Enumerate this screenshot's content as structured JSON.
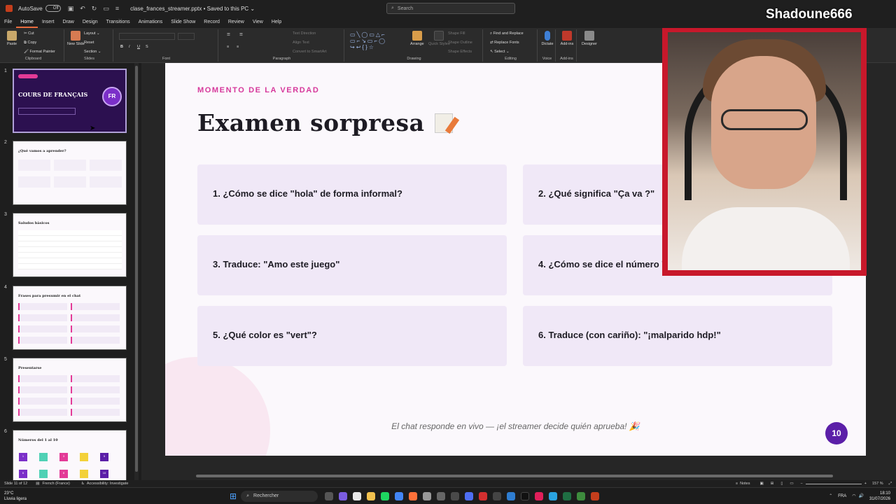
{
  "titlebar": {
    "autosave": "AutoSave",
    "toggle": "Off",
    "doc_title": "clase_frances_streamer.pptx • Saved to this PC ⌄",
    "search_placeholder": "Search"
  },
  "menu": [
    "File",
    "Home",
    "Insert",
    "Draw",
    "Design",
    "Transitions",
    "Animations",
    "Slide Show",
    "Record",
    "Review",
    "View",
    "Help"
  ],
  "ribbon": {
    "clipboard": {
      "paste": "Paste",
      "cut": "Cut",
      "copy": "Copy",
      "format_painter": "Format Painter",
      "name": "Clipboard"
    },
    "slides": {
      "new_slide": "New Slide",
      "layout": "Layout",
      "reset": "Reset",
      "section": "Section",
      "name": "Slides"
    },
    "font": {
      "name": "Font"
    },
    "paragraph": {
      "text_direction": "Text Direction",
      "align_text": "Align Text",
      "convert": "Convert to SmartArt",
      "name": "Paragraph"
    },
    "drawing": {
      "arrange": "Arrange",
      "quick_styles": "Quick Styles",
      "shape_fill": "Shape Fill",
      "shape_outline": "Shape Outline",
      "shape_effects": "Shape Effects",
      "name": "Drawing"
    },
    "editing": {
      "find_replace": "Find and Replace",
      "replace_fonts": "Replace Fonts",
      "select": "Select",
      "name": "Editing"
    },
    "voice": {
      "dictate": "Dictate",
      "name": "Voice"
    },
    "addins": {
      "addins": "Add-ins",
      "name": "Add-ins"
    },
    "designer": {
      "designer": "Designer"
    }
  },
  "thumbnails": [
    {
      "num": "1",
      "title": "COURS DE FRANÇAIS",
      "badge": "FR"
    },
    {
      "num": "2",
      "title": "¿Qué vamos a aprender?"
    },
    {
      "num": "3",
      "title": "Saludos básicos"
    },
    {
      "num": "4",
      "title": "Frases para presumir en el chat"
    },
    {
      "num": "5",
      "title": "Presentarse"
    },
    {
      "num": "6",
      "title": "Números del 1 al 10",
      "cells": [
        "1",
        "",
        "3",
        "",
        "5",
        "6",
        "",
        "8",
        "",
        "10"
      ]
    }
  ],
  "slide": {
    "kicker": "MOMENTO DE LA VERDAD",
    "title": "Examen sorpresa",
    "questions": [
      "1. ¿Cómo se dice \"hola\" de forma informal?",
      "2. ¿Qué significa \"Ça va ?\"",
      "3. Traduce: \"Amo este juego\"",
      "4. ¿Cómo se dice el número 7",
      "5. ¿Qué color es \"vert\"?",
      "6. Traduce (con cariño): \"¡malparido hdp!\""
    ],
    "footer": "El chat responde en vivo — ¡el streamer decide quién aprueba! 🎉",
    "page": "10"
  },
  "streamer": {
    "name": "Shadoune666"
  },
  "statusbar": {
    "slide_info": "Slide 11 of 12",
    "language": "French (France)",
    "accessibility": "Accessibility: Investigate",
    "notes": "Notes",
    "zoom": "157 %"
  },
  "taskbar": {
    "weather_temp": "23°C",
    "weather_desc": "Lluvia ligera",
    "search": "Rechercher",
    "lang": "FRA",
    "time": "18:10",
    "date": "31/07/2026"
  },
  "colors": {
    "accent": "#d6389b",
    "purple": "#5b1fa8",
    "card": "#f0e8f7",
    "webcam_border": "#c8182b"
  }
}
